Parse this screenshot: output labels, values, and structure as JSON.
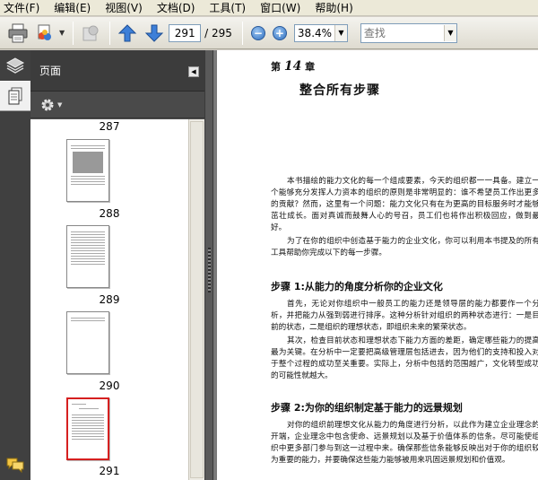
{
  "menu": [
    {
      "label": "文件(F)"
    },
    {
      "label": "编辑(E)"
    },
    {
      "label": "视图(V)"
    },
    {
      "label": "文档(D)"
    },
    {
      "label": "工具(T)"
    },
    {
      "label": "窗口(W)"
    },
    {
      "label": "帮助(H)"
    }
  ],
  "toolbar": {
    "current_page": "291",
    "total_pages": "/ 295",
    "zoom": "38.4%",
    "search_placeholder": "查找",
    "zoom_out": "−",
    "zoom_in": "+"
  },
  "panel": {
    "title": "页面"
  },
  "thumbnails": [
    {
      "label": "287"
    },
    {
      "label": "288"
    },
    {
      "label": "289"
    },
    {
      "label": "290"
    },
    {
      "label": "291"
    }
  ],
  "document": {
    "chapter_prefix": "第",
    "chapter_number": "14",
    "chapter_suffix": "章",
    "chapter_title": "整合所有步骤",
    "intro_1": "本书描绘的能力文化的每一个组成要素，今天的组织都一一具备。建立一个能够充分发挥人力资本的组织的原则是非常明显的：谁不希望员工作出更多的贡献？然而，这里有一个问题：能力文化只有在为更高的目标服务时才能够茁壮成长。面对真诚而鼓舞人心的号召，员工们也将作出积极回应，做到最好。",
    "intro_2": "为了在你的组织中创造基于能力的企业文化，你可以利用本书提及的所有工具帮助你完成以下的每一步骤。",
    "step1_title": "步骤 1:从能力的角度分析你的企业文化",
    "step1_p1": "首先，无论对你组织中一般员工的能力还是领导层的能力都要作一个分析，并把能力从强到弱进行排序。这种分析针对组织的两种状态进行：一是目前的状态，二是组织的理想状态，即组织未来的繁荣状态。",
    "step1_p2": "其次，检查目前状态和理想状态下能力方面的差距，确定哪些能力的提高最为关键。在分析中一定要把高级管理层包括进去，因为他们的支持和投入对于整个过程的成功至关重要。实际上，分析中包括的范围越广，文化转型成功的可能性就越大。",
    "step2_title": "步骤 2:为你的组织制定基于能力的远景规划",
    "step2_p1": "对你的组织前理想文化从能力的角度进行分析，以此作为建立企业理念的开端，企业理念中包含使命、远景规划以及基于价值体系的信条。尽可能使组织中更多部门参与到这一过程中来。确保那些信条能够反映出对于你的组织较为重要的能力，并要确保这些能力能够被用来巩固远景规划和价值观。"
  }
}
